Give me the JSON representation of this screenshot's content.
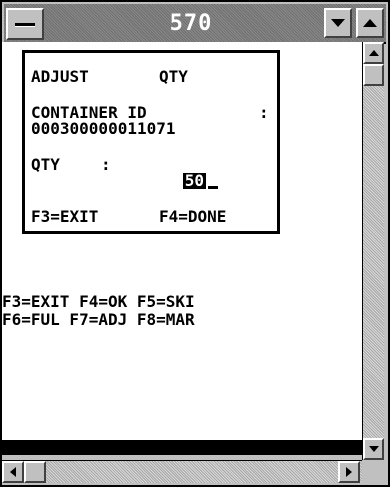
{
  "window": {
    "title": "570"
  },
  "dialog": {
    "heading_left": "ADJUST",
    "heading_right": "QTY",
    "container_label": "CONTAINER ID",
    "container_colon": ":",
    "container_value": "000300000011071",
    "qty_label": "QTY",
    "qty_colon": ":",
    "qty_value": "50",
    "f3": "F3=EXIT",
    "f4": "F4=DONE"
  },
  "function_keys": {
    "row1": "F3=EXIT F4=OK F5=SKI",
    "row2": "F6=FUL F7=ADJ F8=MAR"
  },
  "icons": {
    "system_menu": "system-menu-icon",
    "minimize": "minimize-icon",
    "maximize": "maximize-icon",
    "scroll_up": "arrow-up-icon",
    "scroll_down": "arrow-down-icon",
    "scroll_left": "arrow-left-icon",
    "scroll_right": "arrow-right-icon"
  }
}
